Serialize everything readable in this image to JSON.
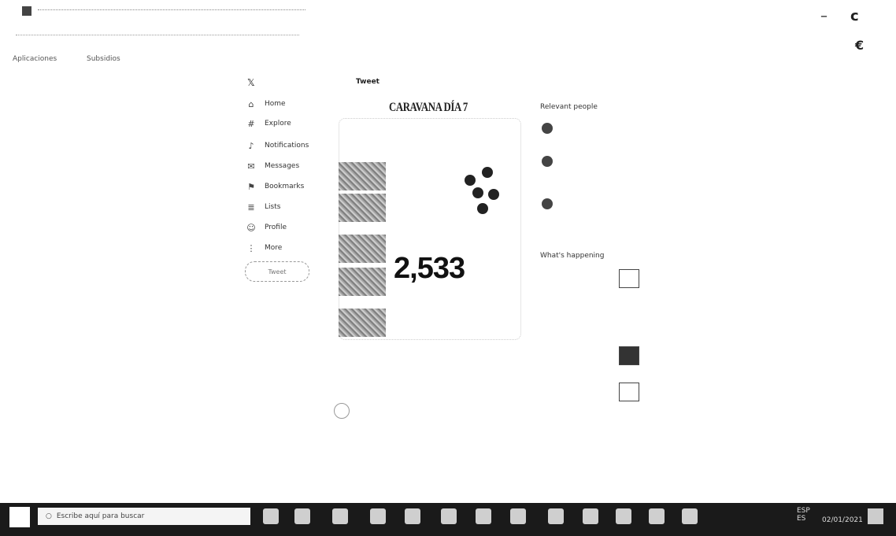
{
  "window": {
    "minimize_glyph": "–",
    "restore_glyph": "c"
  },
  "browser": {
    "bookmarks": [
      {
        "label": "Aplicaciones"
      },
      {
        "label": "Subsidios"
      }
    ]
  },
  "twitter": {
    "nav": [
      {
        "label": "Home",
        "icon": "home-icon",
        "glyph": "⌂"
      },
      {
        "label": "Explore",
        "icon": "hashtag-icon",
        "glyph": "#"
      },
      {
        "label": "Notifications",
        "icon": "bell-icon",
        "glyph": "♪"
      },
      {
        "label": "Messages",
        "icon": "envelope-icon",
        "glyph": "✉"
      },
      {
        "label": "Bookmarks",
        "icon": "bookmark-icon",
        "glyph": "⚑"
      },
      {
        "label": "Lists",
        "icon": "list-icon",
        "glyph": "≣"
      },
      {
        "label": "Profile",
        "icon": "person-icon",
        "glyph": "☺"
      },
      {
        "label": "More",
        "icon": "more-icon",
        "glyph": "⋮"
      }
    ],
    "tweet_button": "Tweet",
    "column_title": "Tweet",
    "headline": "CARAVANA DÍA 7",
    "big_number": "2,533",
    "right": {
      "relevant_heading": "Relevant people",
      "happening_heading": "What's happening"
    }
  },
  "taskbar": {
    "search_placeholder": "Escribe aquí para buscar",
    "lang_top": "ESP",
    "lang_bottom": "ES",
    "date": "02/01/2021"
  }
}
